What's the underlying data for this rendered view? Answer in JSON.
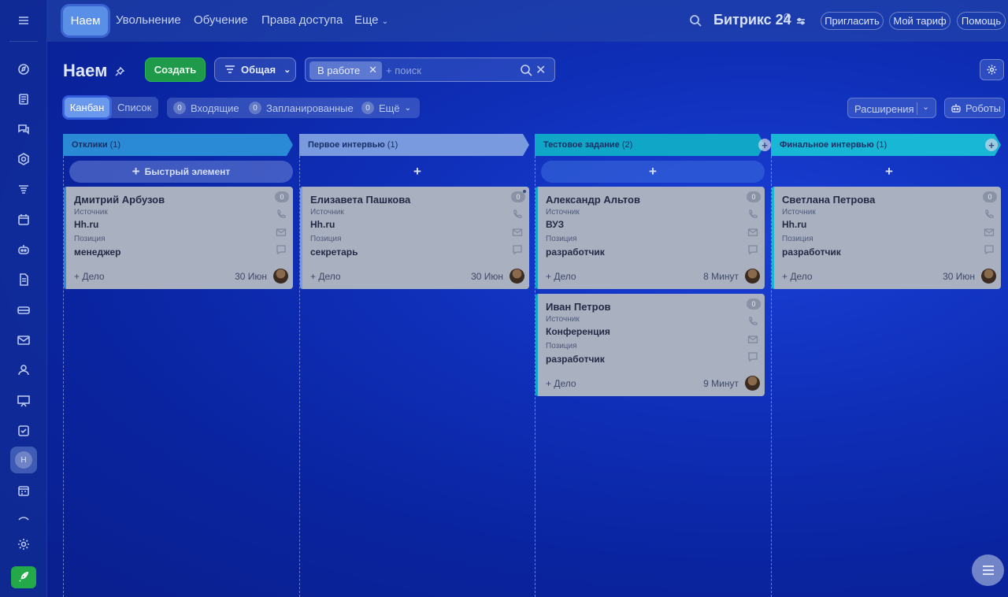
{
  "topbar": {
    "tabs": [
      "Наем",
      "Увольнение",
      "Обучение",
      "Права доступа",
      "Еще"
    ],
    "brand": "Битрикс 24",
    "invite": "Пригласить",
    "tariff": "Мой тариф",
    "help": "Помощь"
  },
  "sidebar": {
    "user_initial": "Н",
    "icons": [
      "compass-icon",
      "news-icon",
      "chat-icon",
      "hexagon-icon",
      "funnel-icon",
      "calendar-icon",
      "robot-icon",
      "document-icon",
      "drive-icon",
      "mail-icon",
      "users-icon",
      "presentation-icon",
      "checkbox-icon",
      "hiring-icon",
      "schedule-icon",
      "collapse-icon",
      "settings-icon",
      "rocket-icon"
    ]
  },
  "page": {
    "title": "Наем",
    "create_label": "Создать",
    "filter_label": "Общая",
    "search_chip": "В работе",
    "search_placeholder": "+ поиск"
  },
  "views": {
    "active": "Канбан",
    "other": "Список",
    "counters": [
      {
        "num": "0",
        "label": "Входящие"
      },
      {
        "num": "0",
        "label": "Запланированные"
      },
      {
        "num": "0",
        "label": "Ещё"
      }
    ],
    "extensions": "Расширения",
    "robots": "Роботы"
  },
  "colors": {
    "col1": "#2a8ad6",
    "col2": "#7a9ae0",
    "col3": "#10a6c8",
    "col4": "#19b7d6"
  },
  "columns": [
    {
      "title": "Отклики",
      "count": "(1)",
      "quick_add": "Быстрый элемент",
      "cards": [
        {
          "name": "Дмитрий Арбузов",
          "source_label": "Источник",
          "source": "Hh.ru",
          "position_label": "Позиция",
          "position": "менеджер",
          "badge": "0",
          "task": "+ Дело",
          "date": "30 Июн"
        }
      ]
    },
    {
      "title": "Первое интервью",
      "count": "(1)",
      "quick_add": "",
      "cards": [
        {
          "name": "Елизавета Пашкова",
          "source_label": "Источник",
          "source": "Hh.ru",
          "position_label": "Позиция",
          "position": "секретарь",
          "badge": "0",
          "task": "+ Дело",
          "date": "30 Июн"
        }
      ]
    },
    {
      "title": "Тестовое задание",
      "count": "(2)",
      "quick_add": "",
      "cards": [
        {
          "name": "Александр Альтов",
          "source_label": "Источник",
          "source": "ВУЗ",
          "position_label": "Позиция",
          "position": "разработчик",
          "badge": "0",
          "task": "+ Дело",
          "date": "8 Минут"
        },
        {
          "name": "Иван Петров",
          "source_label": "Источник",
          "source": "Конференция",
          "position_label": "Позиция",
          "position": "разработчик",
          "badge": "0",
          "task": "+ Дело",
          "date": "9 Минут"
        }
      ]
    },
    {
      "title": "Финальное интервью",
      "count": "(1)",
      "quick_add": "",
      "cards": [
        {
          "name": "Светлана Петрова",
          "source_label": "Источник",
          "source": "Hh.ru",
          "position_label": "Позиция",
          "position": "разработчик",
          "badge": "0",
          "task": "+ Дело",
          "date": "30 Июн"
        }
      ]
    }
  ]
}
